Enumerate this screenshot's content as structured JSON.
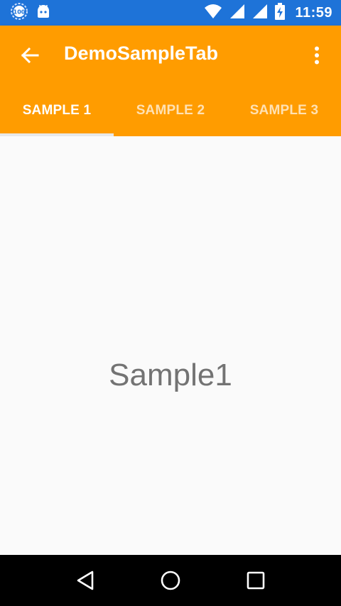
{
  "status_bar": {
    "battery_saver_badge": "100",
    "time": "11:59",
    "icons": [
      "battery-saver-icon",
      "android-icon",
      "wifi-icon",
      "signal-icon",
      "signal-icon-2",
      "battery-charging-icon"
    ]
  },
  "app_bar": {
    "title": "DemoSampleTab",
    "background_color": "#ff9c00",
    "back_icon": "arrow-back-icon",
    "overflow_icon": "more-vert-icon"
  },
  "tabs": [
    {
      "label": "SAMPLE 1",
      "active": true
    },
    {
      "label": "SAMPLE 2",
      "active": false
    },
    {
      "label": "SAMPLE 3",
      "active": false
    }
  ],
  "content": {
    "text": "Sample1"
  },
  "nav_bar": {
    "icons": [
      "back-triangle-icon",
      "home-circle-icon",
      "recents-square-icon"
    ]
  }
}
